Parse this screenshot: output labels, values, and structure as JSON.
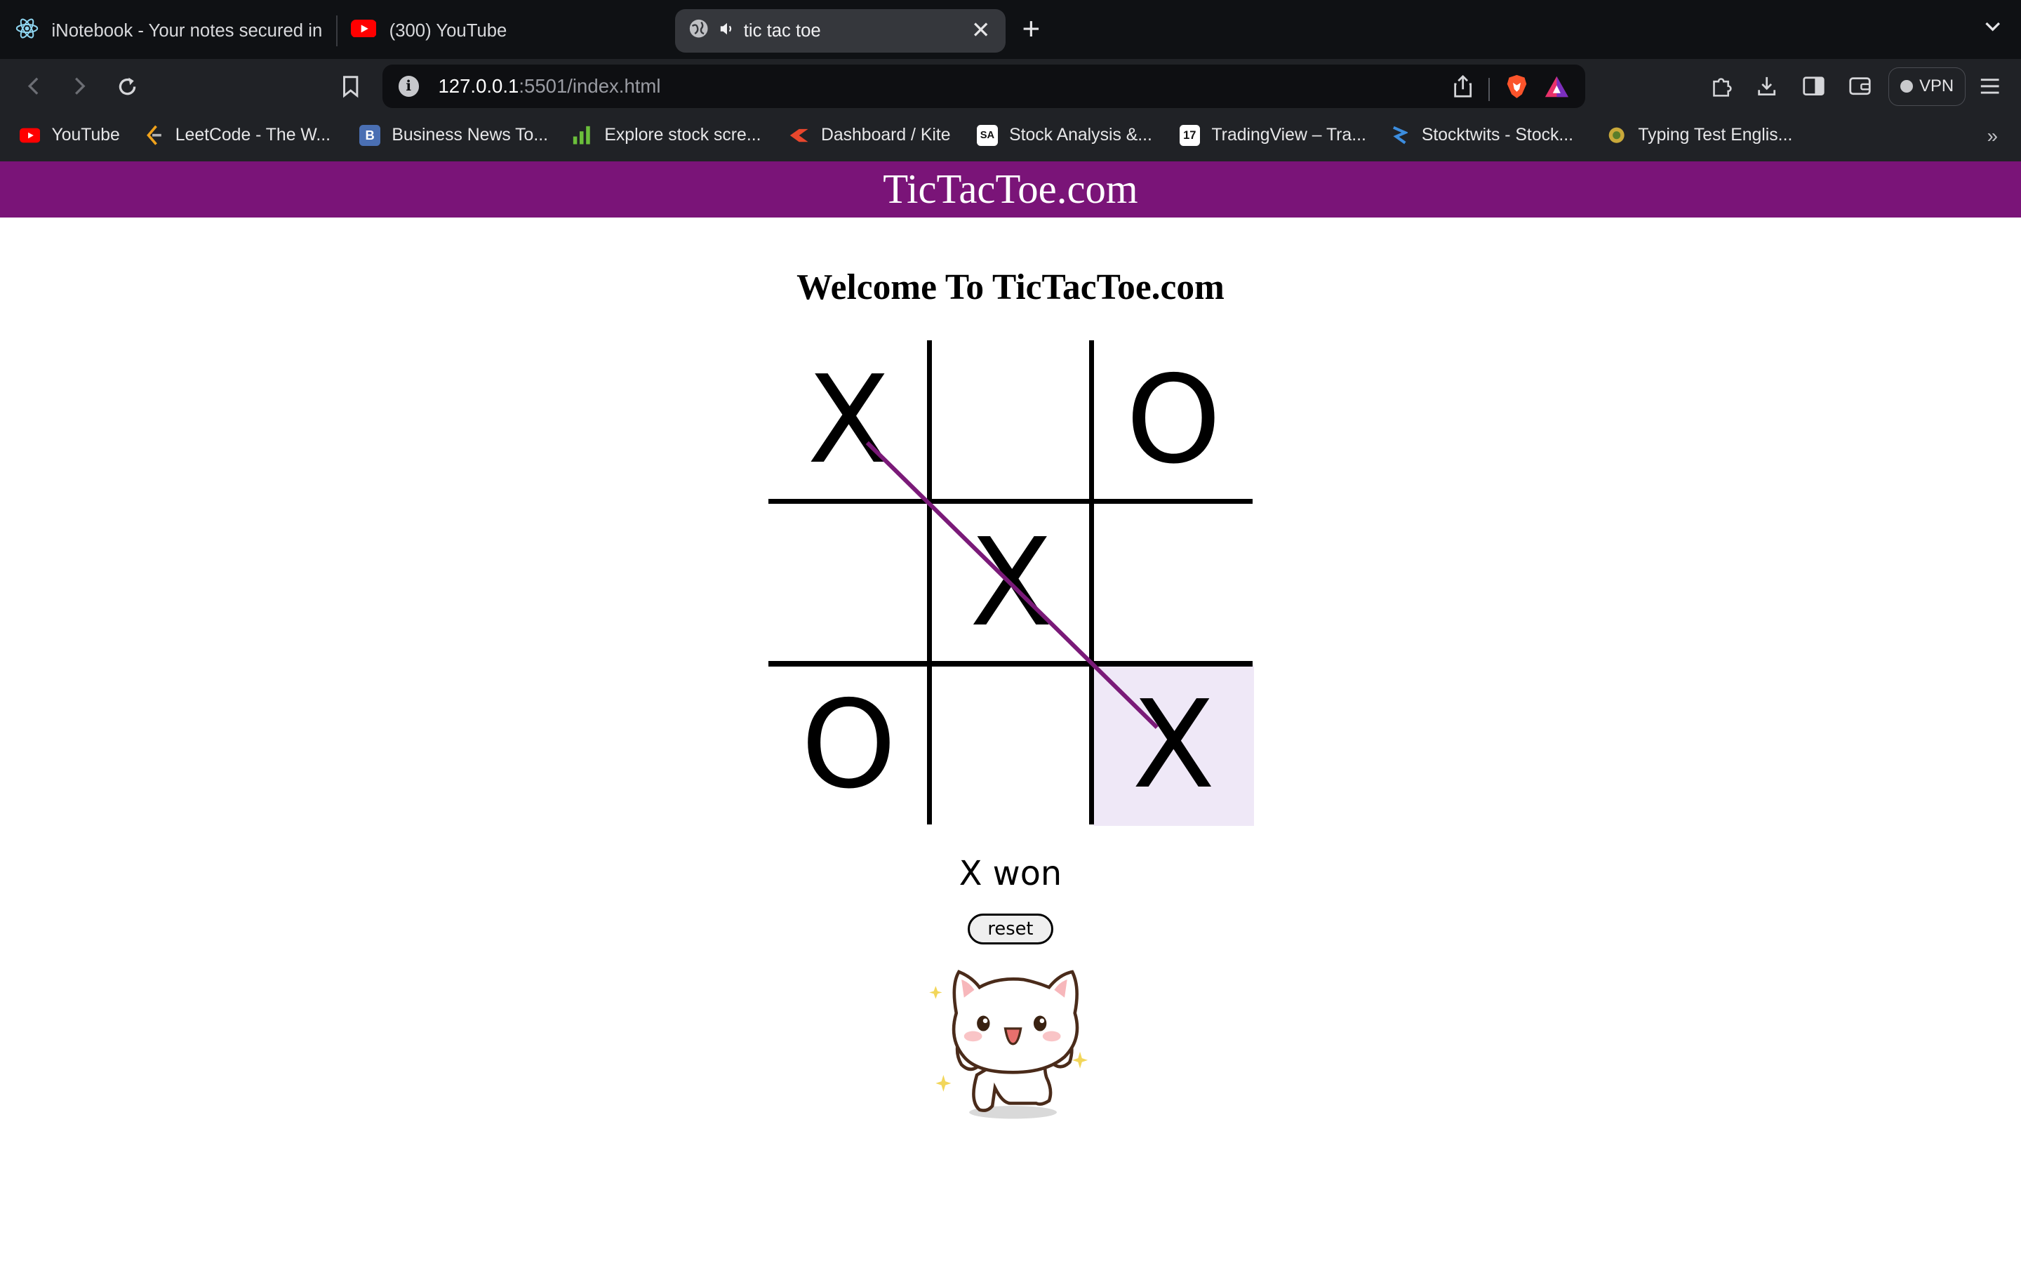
{
  "browser": {
    "tabs": [
      {
        "title": "iNotebook - Your notes secured in the cloud",
        "active": false
      },
      {
        "title": "(300) YouTube",
        "active": false
      },
      {
        "title": "tic tac toe",
        "active": true
      }
    ],
    "url": {
      "host": "127.0.0.1",
      "rest": ":5501/index.html"
    },
    "vpn_label": "VPN",
    "bookmarks": [
      "YouTube",
      "LeetCode - The W...",
      "Business News To...",
      "Explore stock scre...",
      "Dashboard / Kite",
      "Stock Analysis &...",
      "TradingView – Tra...",
      "Stocktwits - Stock...",
      "Typing Test Englis..."
    ]
  },
  "site": {
    "header_title": "TicTacToe.com",
    "welcome": "Welcome To TicTacToe.com"
  },
  "game": {
    "board": [
      "X",
      "",
      "O",
      "",
      "X",
      "",
      "O",
      "",
      "X"
    ],
    "winning_cells": [
      0,
      4,
      8
    ],
    "status": "X won",
    "reset_label": "reset"
  },
  "colors": {
    "header_bg": "#7a1478",
    "strike_line": "#7a1a78",
    "highlight_cell": "#efe8f7"
  }
}
